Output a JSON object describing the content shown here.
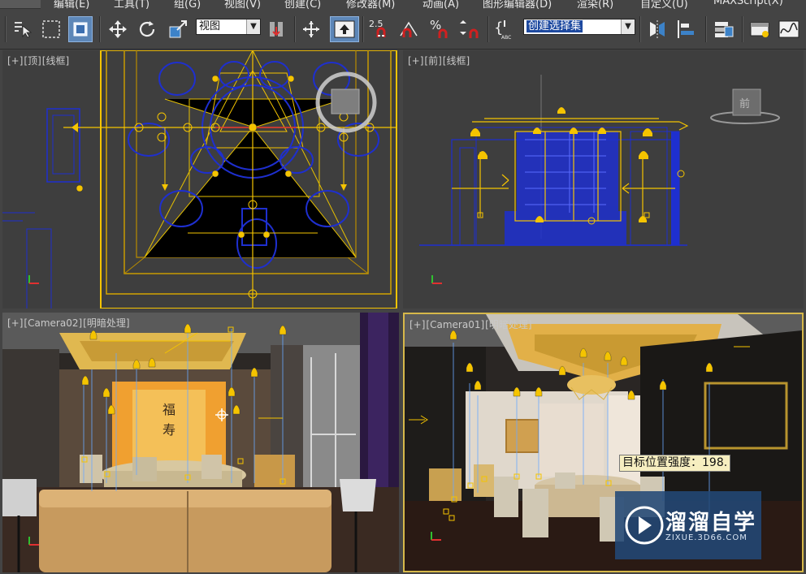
{
  "menu": [
    {
      "key": "edit",
      "label": "编辑(E)"
    },
    {
      "key": "tools",
      "label": "工具(T)"
    },
    {
      "key": "group",
      "label": "组(G)"
    },
    {
      "key": "views",
      "label": "视图(V)"
    },
    {
      "key": "create",
      "label": "创建(C)"
    },
    {
      "key": "modifiers",
      "label": "修改器(M)"
    },
    {
      "key": "animation",
      "label": "动画(A)"
    },
    {
      "key": "graph_editors",
      "label": "图形编辑器(D)"
    },
    {
      "key": "rendering",
      "label": "渲染(R)"
    },
    {
      "key": "customize",
      "label": "自定义(U)"
    },
    {
      "key": "maxscript",
      "label": "MAXScript(X)"
    }
  ],
  "toolbar": {
    "reference_coord": "视图",
    "snap_angle_label": "2.5",
    "percent_snap_label": "%",
    "edit_named_sel_label": "ABC",
    "named_selection_set": "创建选择集"
  },
  "viewports": {
    "top": {
      "plus": "[+]",
      "name": "[顶]",
      "mode": "[线框]"
    },
    "front": {
      "plus": "[+]",
      "name": "[前]",
      "mode": "[线框]",
      "viewcube_label": "前"
    },
    "camera02": {
      "plus": "[+]",
      "name": "[Camera02]",
      "mode": "[明暗处理]"
    },
    "camera01": {
      "plus": "[+]",
      "name": "[Camera01]",
      "mode": "[明暗处理]"
    }
  },
  "tooltip": "目标位置强度：198.",
  "watermark": {
    "title": "溜溜自学",
    "url": "ZIXUE.3D66.COM"
  },
  "colors": {
    "ui_bg": "#444444",
    "viewport_bg": "#3e3e3e",
    "wire_blue": "#1e2fcf",
    "light_yellow": "#f5c400",
    "active_border": "#d6b84a",
    "button_active": "#5d87b8"
  }
}
